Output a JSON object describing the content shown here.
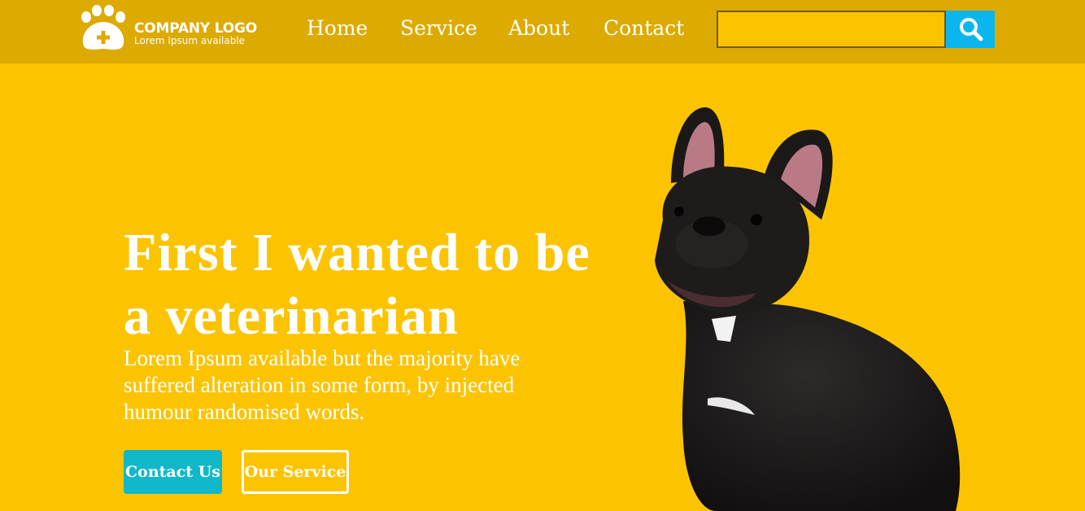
{
  "header": {
    "logo": {
      "title": "COMPANY LOGO",
      "subtitle": "Lorem Ipsum available",
      "icon": "paw-plus-icon"
    },
    "nav": [
      {
        "label": "Home"
      },
      {
        "label": "Service"
      },
      {
        "label": "About"
      },
      {
        "label": "Contact"
      }
    ],
    "search": {
      "value": "",
      "placeholder": "",
      "button_icon": "search-icon"
    }
  },
  "hero": {
    "title_line1": "First I wanted to be",
    "title_line2": "a veterinarian",
    "description": "Lorem Ipsum available but the majority have suffered alteration in some form, by injected humour randomised words.",
    "primary_button": "Contact Us",
    "secondary_button": "Our Service",
    "image": "french-bulldog-photo"
  },
  "colors": {
    "background": "#fcc400",
    "header": "#dcaa00",
    "search_button": "#0ab6ec",
    "contact_button": "#11b8c9",
    "text": "#ffffff"
  }
}
